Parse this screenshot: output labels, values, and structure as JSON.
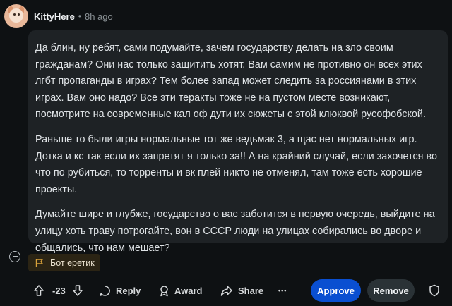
{
  "comment": {
    "author": "KittyHere",
    "separator": "•",
    "time": "8h ago",
    "paragraphs": [
      "Да блин, ну ребят, сами подумайте, зачем государству делать на зло своим гражданам? Они нас только защитить хотят. Вам самим не противно он всех этих лгбт пропаганды в играх? Тем более запад может следить за россиянами в этих играх. Вам оно надо? Все эти теракты тоже не на пустом месте возникают, посмотрите на современные кал оф дути их сюжеты с этой клюквой русофобской.",
      "Раньше то были игры нормальные тот же ведьмак 3, а щас нет нормальных игр. Дотка и кс так если их запретят я только за!! А на крайний случай, если захочется во что по рубиться, то торренты и вк плей никто не отменял, там тоже есть хорошие проекты.",
      "Думайте шире и глубже, государство о вас заботится в первую очередь, выйдите на улицу хоть траву потрогайте, вон в СССР люди на улицах собирались во дворе и общались, что нам мешает?"
    ],
    "flair": "Бот еретик",
    "score": "-23"
  },
  "actions": {
    "reply": "Reply",
    "award": "Award",
    "share": "Share",
    "more": "•••",
    "approve": "Approve",
    "remove": "Remove"
  },
  "colors": {
    "background": "#0e1113",
    "bubble": "#1e2225",
    "approve": "#0a4fd1",
    "remove": "#2a3236",
    "flair_bg": "#2b2414",
    "flair_icon": "#d9a23a"
  },
  "icons": [
    "avatar-cat",
    "flag-icon",
    "upvote-icon",
    "downvote-icon",
    "reply-icon",
    "award-icon",
    "share-icon",
    "more-icon",
    "shield-icon",
    "collapse-icon"
  ]
}
